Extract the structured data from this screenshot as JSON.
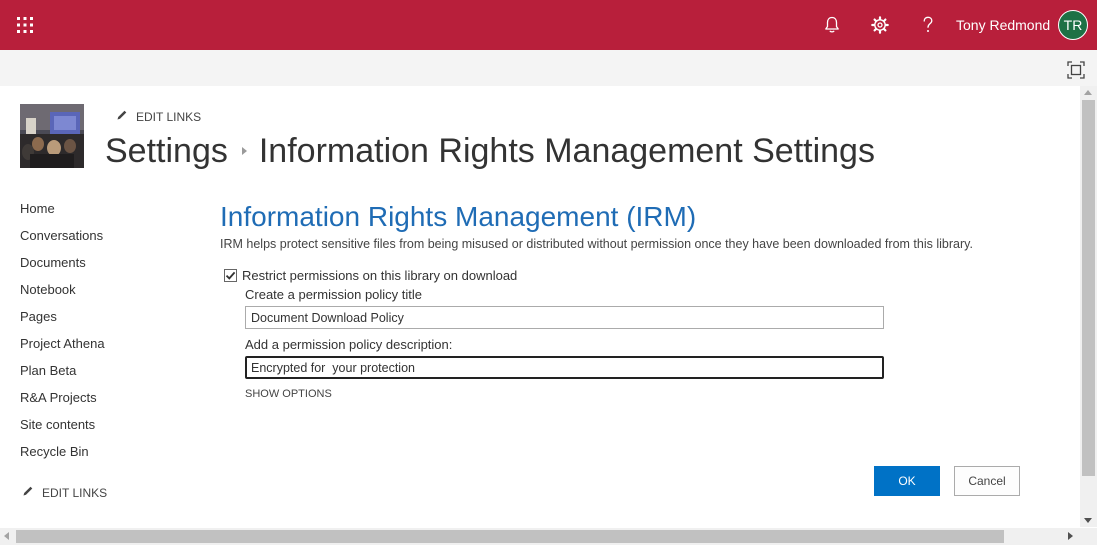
{
  "suite_bar": {
    "background_color": "#b81f3b",
    "waffle_icon": "app-launcher-waffle-icon",
    "notifications_icon": "bell-icon",
    "settings_icon": "gear-icon",
    "help_icon": "question-mark-icon",
    "user_name": "Tony Redmond",
    "avatar_initials": "TR",
    "avatar_color": "#1e7145"
  },
  "command_bar": {
    "focus_icon": "focus-mode-icon"
  },
  "header": {
    "edit_links_label": "EDIT LINKS",
    "breadcrumb": [
      "Settings",
      "Information Rights Management Settings"
    ]
  },
  "quick_launch": {
    "items": [
      "Home",
      "Conversations",
      "Documents",
      "Notebook",
      "Pages",
      "Project Athena",
      "Plan Beta",
      "R&A Projects",
      "Site contents",
      "Recycle Bin"
    ],
    "edit_links_label": "EDIT LINKS"
  },
  "irm": {
    "title": "Information Rights Management (IRM)",
    "title_color": "#1f6cb5",
    "description": "IRM helps protect sensitive files from being misused or distributed without permission once they have been downloaded from this library.",
    "restrict_label": "Restrict permissions on this library on download",
    "restrict_checked": true,
    "policy_title_label": "Create a permission policy title",
    "policy_title_value": "Document Download Policy",
    "policy_desc_label": "Add a permission policy description:",
    "policy_desc_value": "Encrypted for  your protection",
    "show_options_label": "SHOW OPTIONS"
  },
  "actions": {
    "ok_label": "OK",
    "cancel_label": "Cancel",
    "primary_color": "#0072c6"
  }
}
